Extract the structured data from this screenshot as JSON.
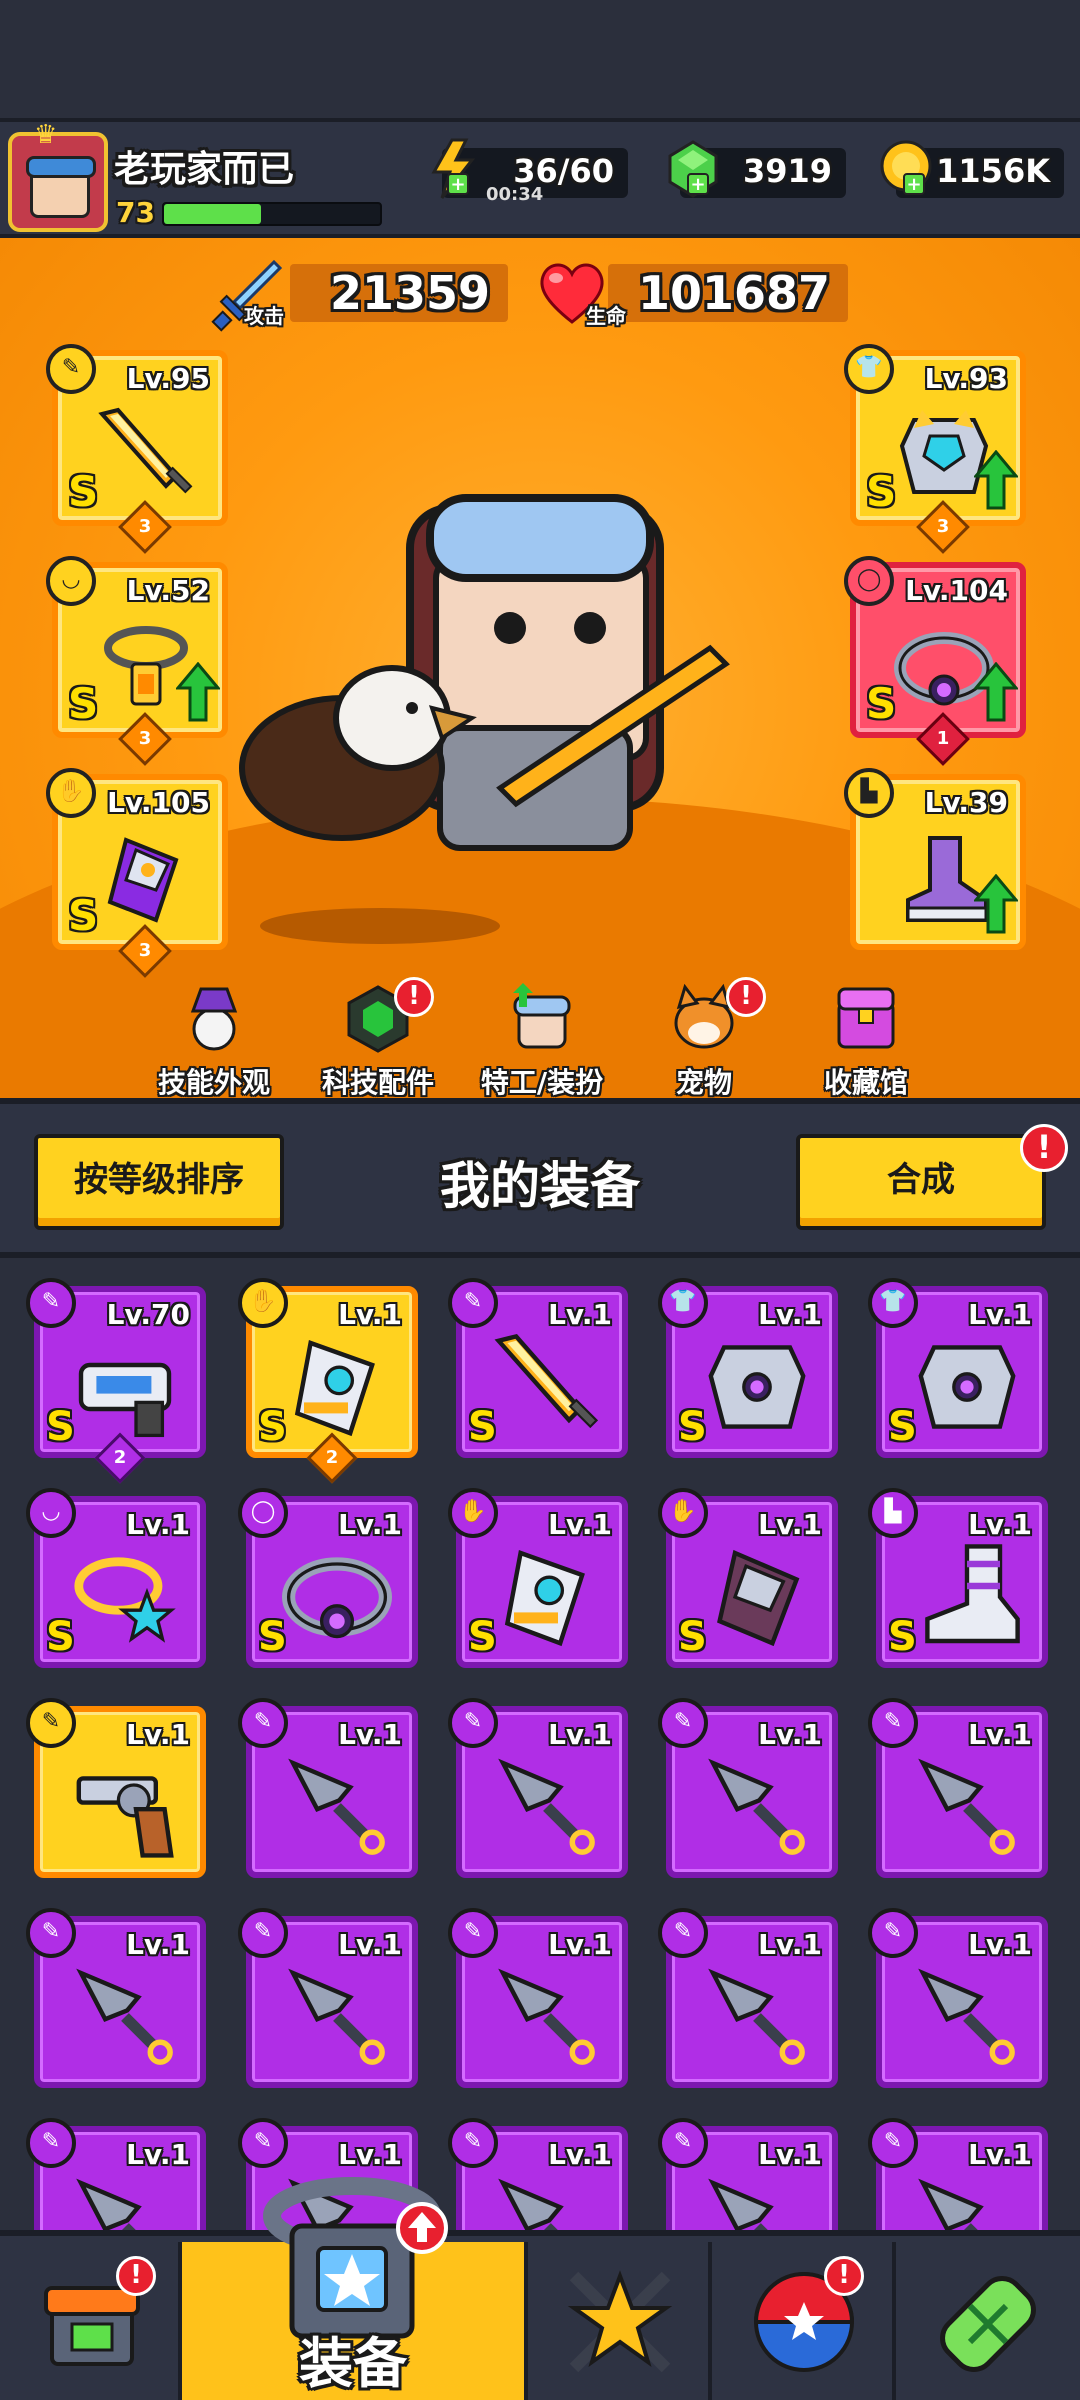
{
  "player": {
    "name": "老玩家而已",
    "level": "73",
    "xp_progress": 0.45
  },
  "resources": {
    "energy": "36/60",
    "energy_timer": "00:34",
    "gems": "3919",
    "coins": "1156K"
  },
  "stats": {
    "attack_value": "21359",
    "attack_label": "攻击",
    "life_value": "101687",
    "life_label": "生命"
  },
  "equipped": {
    "weapon": {
      "level": "Lv.95",
      "grade": "S",
      "stars": "3"
    },
    "necklace": {
      "level": "Lv.52",
      "grade": "S",
      "stars": "3"
    },
    "gloves": {
      "level": "Lv.105",
      "grade": "S",
      "stars": "3"
    },
    "armor": {
      "level": "Lv.93",
      "grade": "S",
      "stars": "3"
    },
    "ring": {
      "level": "Lv.104",
      "grade": "S",
      "stars": "1"
    },
    "boots": {
      "level": "Lv.39",
      "grade": "S",
      "stars": ""
    }
  },
  "menu": {
    "skills": "技能外观",
    "tech": "科技配件",
    "agents": "特工/装扮",
    "pets": "宠物",
    "collection": "收藏馆",
    "alert": "!"
  },
  "inventory_header": {
    "sort_button": "按等级排序",
    "title": "我的装备",
    "merge_button": "合成",
    "alert": "!"
  },
  "inventory": [
    {
      "level": "Lv.70",
      "grade": "S",
      "stars": "2",
      "rarity": "purple",
      "type": "weapon",
      "art": "blaster"
    },
    {
      "level": "Lv.1",
      "grade": "S",
      "stars": "2",
      "rarity": "gold",
      "type": "gloves",
      "art": "gauntlet"
    },
    {
      "level": "Lv.1",
      "grade": "S",
      "stars": "",
      "rarity": "purple",
      "type": "weapon",
      "art": "sword"
    },
    {
      "level": "Lv.1",
      "grade": "S",
      "stars": "",
      "rarity": "purple",
      "type": "armor",
      "art": "armor"
    },
    {
      "level": "Lv.1",
      "grade": "S",
      "stars": "",
      "rarity": "purple",
      "type": "armor",
      "art": "armor"
    },
    {
      "level": "Lv.1",
      "grade": "S",
      "stars": "",
      "rarity": "purple",
      "type": "necklace",
      "art": "starring"
    },
    {
      "level": "Lv.1",
      "grade": "S",
      "stars": "",
      "rarity": "purple",
      "type": "ring",
      "art": "belt"
    },
    {
      "level": "Lv.1",
      "grade": "S",
      "stars": "",
      "rarity": "purple",
      "type": "gloves",
      "art": "gauntlet"
    },
    {
      "level": "Lv.1",
      "grade": "S",
      "stars": "",
      "rarity": "purple",
      "type": "gloves",
      "art": "claw"
    },
    {
      "level": "Lv.1",
      "grade": "S",
      "stars": "",
      "rarity": "purple",
      "type": "boots",
      "art": "boot"
    },
    {
      "level": "Lv.1",
      "grade": "",
      "stars": "",
      "rarity": "gold",
      "type": "weapon",
      "art": "revolver"
    },
    {
      "level": "Lv.1",
      "grade": "",
      "stars": "",
      "rarity": "purple",
      "type": "weapon",
      "art": "kunai"
    },
    {
      "level": "Lv.1",
      "grade": "",
      "stars": "",
      "rarity": "purple",
      "type": "weapon",
      "art": "kunai"
    },
    {
      "level": "Lv.1",
      "grade": "",
      "stars": "",
      "rarity": "purple",
      "type": "weapon",
      "art": "kunai"
    },
    {
      "level": "Lv.1",
      "grade": "",
      "stars": "",
      "rarity": "purple",
      "type": "weapon",
      "art": "kunai"
    },
    {
      "level": "Lv.1",
      "grade": "",
      "stars": "",
      "rarity": "purple",
      "type": "weapon",
      "art": "kunai"
    },
    {
      "level": "Lv.1",
      "grade": "",
      "stars": "",
      "rarity": "purple",
      "type": "weapon",
      "art": "kunai"
    },
    {
      "level": "Lv.1",
      "grade": "",
      "stars": "",
      "rarity": "purple",
      "type": "weapon",
      "art": "kunai"
    },
    {
      "level": "Lv.1",
      "grade": "",
      "stars": "",
      "rarity": "purple",
      "type": "weapon",
      "art": "kunai"
    },
    {
      "level": "Lv.1",
      "grade": "",
      "stars": "",
      "rarity": "purple",
      "type": "weapon",
      "art": "kunai"
    },
    {
      "level": "Lv.1",
      "grade": "",
      "stars": "",
      "rarity": "purple",
      "type": "weapon",
      "art": "kunai"
    },
    {
      "level": "Lv.1",
      "grade": "",
      "stars": "",
      "rarity": "purple",
      "type": "weapon",
      "art": "kunai"
    },
    {
      "level": "Lv.1",
      "grade": "",
      "stars": "",
      "rarity": "purple",
      "type": "weapon",
      "art": "kunai"
    },
    {
      "level": "Lv.1",
      "grade": "",
      "stars": "",
      "rarity": "purple",
      "type": "weapon",
      "art": "kunai"
    },
    {
      "level": "Lv.1",
      "grade": "",
      "stars": "",
      "rarity": "purple",
      "type": "weapon",
      "art": "kunai"
    }
  ],
  "bottom_nav": {
    "shop_icon": "shop-icon",
    "equip_label": "装备",
    "battle_icon": "star-swords-icon",
    "gacha_icon": "star-ball-icon",
    "gene_icon": "dna-capsule-icon",
    "alert": "!"
  },
  "colors": {
    "purple": "#b02ee6",
    "gold": "#ffd21f",
    "orange_bg": "#ff9a10",
    "alert_red": "#e8202f"
  }
}
